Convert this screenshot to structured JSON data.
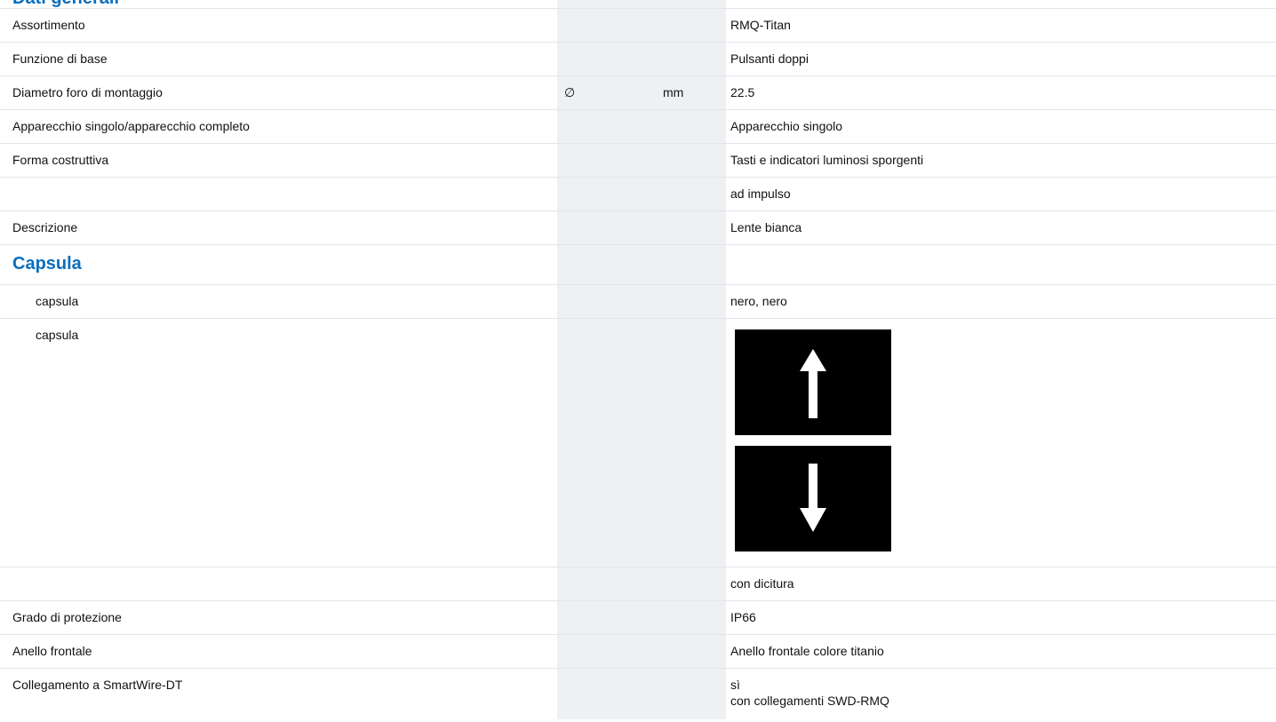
{
  "top_heading_partial": "Dati generali",
  "rows": [
    {
      "label": "Assortimento",
      "value": "RMQ-Titan"
    },
    {
      "label": "Funzione di base",
      "value": "Pulsanti doppi"
    },
    {
      "label": "Diametro foro di montaggio",
      "symbol": "∅",
      "unit": "mm",
      "value": "22.5"
    },
    {
      "label": "Apparecchio singolo/apparecchio completo",
      "value": "Apparecchio singolo"
    },
    {
      "label": "Forma costruttiva",
      "value": "Tasti e indicatori luminosi sporgenti"
    },
    {
      "label": "",
      "value": "ad impulso"
    },
    {
      "label": "Descrizione",
      "value": "Lente bianca"
    }
  ],
  "section_capsula": "Capsula",
  "capsula_rows": [
    {
      "label": "capsula",
      "value": "nero, nero"
    },
    {
      "label": "capsula",
      "image": "double-pushbutton-arrows-up-down"
    }
  ],
  "rows_after": [
    {
      "label": "",
      "value": "con dicitura"
    },
    {
      "label": "Grado di protezione",
      "value": "IP66"
    },
    {
      "label": "Anello frontale",
      "value": "Anello frontale colore titanio"
    },
    {
      "label": "Collegamento a SmartWire-DT",
      "value_lines": [
        "sì",
        "con collegamenti SWD-RMQ"
      ]
    }
  ],
  "colors": {
    "accent": "#0a6ebd",
    "shade": "#eef0f4",
    "rule": "#e3e5e8"
  }
}
